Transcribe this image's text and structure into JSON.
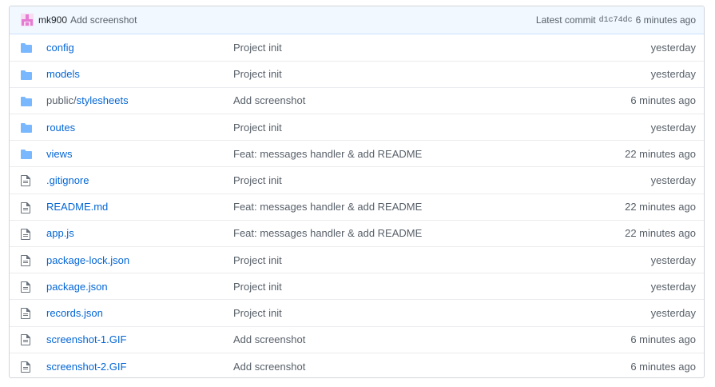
{
  "commit": {
    "author": "mk900",
    "message": "Add screenshot",
    "latest_label": "Latest commit",
    "sha": "d1c74dc",
    "time": "6 minutes ago"
  },
  "files": [
    {
      "type": "folder",
      "prefix": "",
      "name": "config",
      "message": "Project init",
      "age": "yesterday"
    },
    {
      "type": "folder",
      "prefix": "",
      "name": "models",
      "message": "Project init",
      "age": "yesterday"
    },
    {
      "type": "folder",
      "prefix": "public/",
      "name": "stylesheets",
      "message": "Add screenshot",
      "age": "6 minutes ago"
    },
    {
      "type": "folder",
      "prefix": "",
      "name": "routes",
      "message": "Project init",
      "age": "yesterday"
    },
    {
      "type": "folder",
      "prefix": "",
      "name": "views",
      "message": "Feat: messages handler & add README",
      "age": "22 minutes ago"
    },
    {
      "type": "file",
      "prefix": "",
      "name": ".gitignore",
      "message": "Project init",
      "age": "yesterday"
    },
    {
      "type": "file",
      "prefix": "",
      "name": "README.md",
      "message": "Feat: messages handler & add README",
      "age": "22 minutes ago"
    },
    {
      "type": "file",
      "prefix": "",
      "name": "app.js",
      "message": "Feat: messages handler & add README",
      "age": "22 minutes ago"
    },
    {
      "type": "file",
      "prefix": "",
      "name": "package-lock.json",
      "message": "Project init",
      "age": "yesterday"
    },
    {
      "type": "file",
      "prefix": "",
      "name": "package.json",
      "message": "Project init",
      "age": "yesterday"
    },
    {
      "type": "file",
      "prefix": "",
      "name": "records.json",
      "message": "Project init",
      "age": "yesterday"
    },
    {
      "type": "file",
      "prefix": "",
      "name": "screenshot-1.GIF",
      "message": "Add screenshot",
      "age": "6 minutes ago"
    },
    {
      "type": "file",
      "prefix": "",
      "name": "screenshot-2.GIF",
      "message": "Add screenshot",
      "age": "6 minutes ago"
    }
  ],
  "colors": {
    "link": "#0366d6",
    "folder_icon": "#79b8ff",
    "file_icon": "#6a737d",
    "avatar": "#e57bd3"
  }
}
